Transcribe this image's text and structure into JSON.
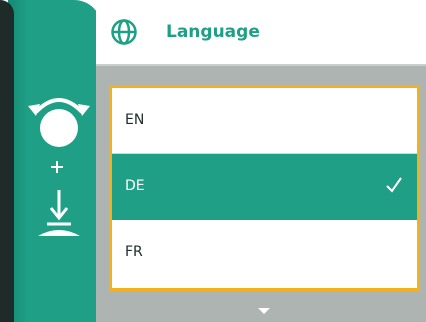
{
  "header": {
    "title": "Language",
    "icon": "globe-icon",
    "accent_color": "#1fa086"
  },
  "side_panel": {
    "icons": [
      "rotate-knob-icon",
      "plus-icon",
      "press-down-icon"
    ],
    "color": "#1fa086"
  },
  "language_list": {
    "items": [
      {
        "label": "EN",
        "selected": false
      },
      {
        "label": "DE",
        "selected": true
      },
      {
        "label": "FR",
        "selected": false
      }
    ],
    "focus_border_color": "#f3b21b",
    "selected_icon": "checkmark-icon"
  },
  "scroll_indicator": {
    "icon": "chevron-down-icon"
  }
}
